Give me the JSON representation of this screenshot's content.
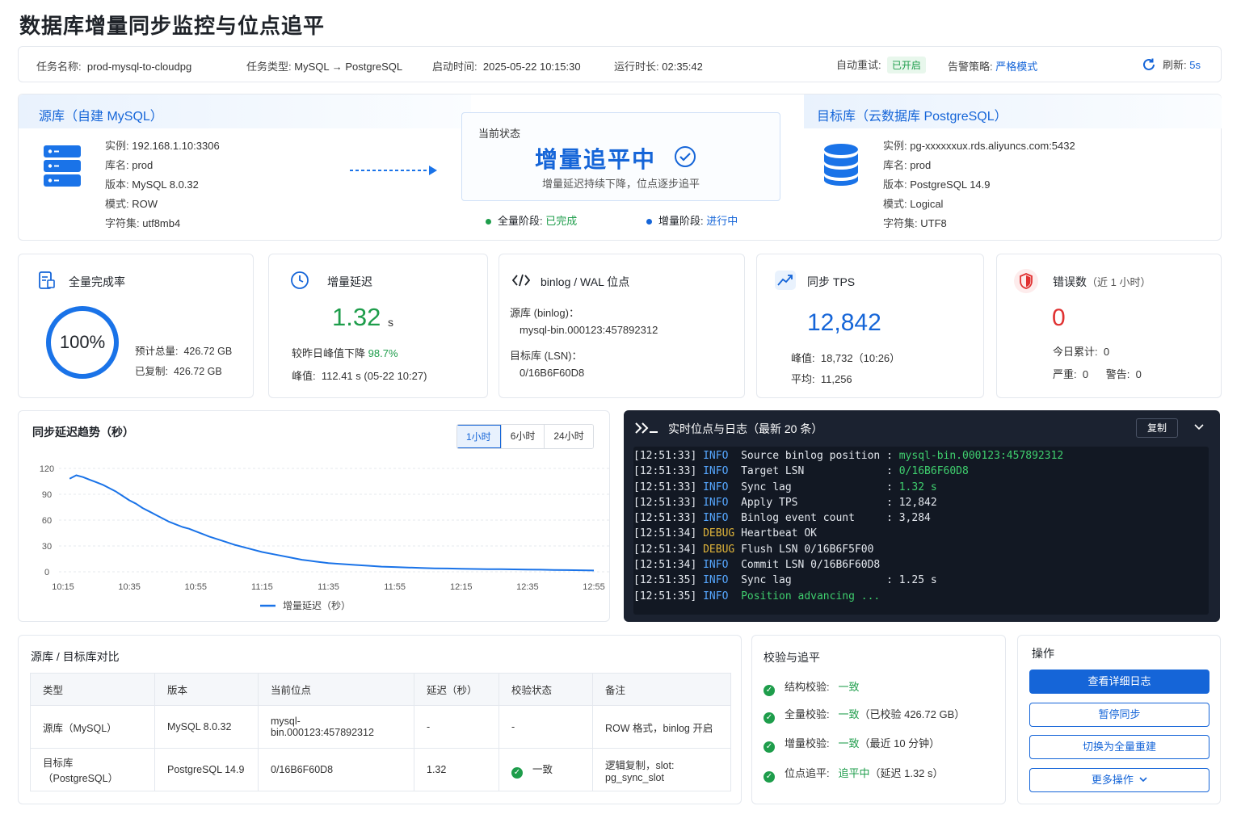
{
  "page_title": "数据库增量同步监控与位点追平",
  "infobar": {
    "task_name_label": "任务名称:",
    "task_name": "prod-mysql-to-cloudpg",
    "task_type_label": "任务类型:",
    "task_type": "MySQL → PostgreSQL",
    "start_time_label": "启动时间:",
    "start_time": "2025-05-22 10:15:30",
    "run_time_label": "运行时长:",
    "run_time": "02:35:42",
    "auto_retry_label": "自动重试:",
    "auto_retry": "已开启",
    "alert_label": "告警策略:",
    "alert": "严格模式",
    "refresh_label": "刷新:",
    "refresh": "5s"
  },
  "source": {
    "header": "源库（自建 MySQL）",
    "instance_label": "实例:",
    "instance": "192.168.1.10:3306",
    "db_label": "库名:",
    "db": "prod",
    "version_label": "版本:",
    "version": "MySQL 8.0.32",
    "mode_label": "模式:",
    "mode": "ROW",
    "charset_label": "字符集:",
    "charset": "utf8mb4"
  },
  "state": {
    "label": "当前状态",
    "value": "增量追平中",
    "sub": "增量延迟持续下降，位点逐步追平",
    "full_stage_label": "全量阶段:",
    "full_stage": "已完成",
    "incr_stage_label": "增量阶段:",
    "incr_stage": "进行中"
  },
  "target": {
    "header": "目标库（云数据库 PostgreSQL）",
    "instance_label": "实例:",
    "instance": "pg-xxxxxxux.rds.aliyuncs.com:5432",
    "db_label": "库名:",
    "db": "prod",
    "version_label": "版本:",
    "version": "PostgreSQL 14.9",
    "mode_label": "模式:",
    "mode": "Logical",
    "charset_label": "字符集:",
    "charset": "UTF8"
  },
  "metrics": {
    "full": {
      "title": "全量完成率",
      "percent": "100%",
      "percent_value": 1.0,
      "total_label": "预计总量:",
      "total": "426.72 GB",
      "copied_label": "已复制:",
      "copied": "426.72 GB"
    },
    "lag": {
      "title": "增量延迟",
      "value": "1.32",
      "unit": "s",
      "compare_label": "较昨日峰值下降",
      "compare": "98.7%",
      "peak_label": "峰值:",
      "peak": "112.41 s (05-22 10:27)"
    },
    "pos": {
      "title": "binlog / WAL 位点",
      "src_label": "源库 (binlog)：",
      "src": "mysql-bin.000123:457892312",
      "dst_label": "目标库 (LSN)：",
      "dst": "0/16B6F60D8"
    },
    "tps": {
      "title": "同步 TPS",
      "value": "12,842",
      "peak_label": "峰值:",
      "peak": "18,732（10:26）",
      "avg_label": "平均:",
      "avg": "11,256"
    },
    "err": {
      "title": "错误数",
      "title_sub": "（近 1 小时）",
      "value": "0",
      "today_label": "今日累计:",
      "today": "0",
      "severe_label": "严重:",
      "severe": "0",
      "warn_label": "警告:",
      "warn": "0"
    }
  },
  "chart": {
    "title": "同步延迟趋势（秒）",
    "ranges": [
      "1小时",
      "6小时",
      "24小时"
    ],
    "active_range": "1小时",
    "legend": "增量延迟（秒）"
  },
  "chart_data": {
    "type": "line",
    "ylim": [
      0,
      120
    ],
    "yticks": [
      "120",
      "90",
      "60",
      "30",
      "0"
    ],
    "xticks": [
      "10:15",
      "10:35",
      "10:55",
      "11:15",
      "11:35",
      "11:55",
      "12:15",
      "12:35",
      "12:55"
    ],
    "series": [
      {
        "name": "增量延迟（秒）",
        "x": [
          "10:17",
          "10:19",
          "10:21",
          "10:23",
          "10:25",
          "10:27",
          "10:29",
          "10:31",
          "10:33",
          "10:35",
          "10:37",
          "10:39",
          "10:41",
          "10:43",
          "10:45",
          "10:47",
          "10:49",
          "10:51",
          "10:53",
          "10:55",
          "10:59",
          "11:03",
          "11:07",
          "11:11",
          "11:15",
          "11:19",
          "11:23",
          "11:27",
          "11:31",
          "11:35",
          "11:39",
          "11:43",
          "11:47",
          "11:51",
          "11:55",
          "11:59",
          "12:03",
          "12:07",
          "12:11",
          "12:15",
          "12:19",
          "12:23",
          "12:27",
          "12:31",
          "12:35",
          "12:39",
          "12:43",
          "12:47",
          "12:51",
          "12:55"
        ],
        "values": [
          108,
          112,
          110,
          107,
          104,
          101,
          97,
          93,
          88,
          83,
          79,
          74,
          70,
          66,
          62,
          58,
          55,
          52,
          50,
          47,
          41,
          36,
          31,
          27,
          23,
          20,
          17,
          14,
          12,
          10,
          9,
          8,
          7,
          6,
          5.5,
          5,
          4.5,
          4,
          3.8,
          3.5,
          3.3,
          3.1,
          3.0,
          2.8,
          2.6,
          2.4,
          2.2,
          2.0,
          1.8,
          1.5
        ]
      }
    ]
  },
  "log": {
    "title": "实时位点与日志（最新 20 条）",
    "copy": "复制",
    "lines": [
      {
        "t": "[12:51:33]",
        "lvl": "INFO",
        "msg": "Source binlog position : ",
        "hl": "mysql-bin.000123:457892312"
      },
      {
        "t": "[12:51:33]",
        "lvl": "INFO",
        "msg": "Target LSN             : ",
        "hl": "0/16B6F60D8"
      },
      {
        "t": "[12:51:33]",
        "lvl": "INFO",
        "msg": "Sync lag               : ",
        "hl": "1.32 s"
      },
      {
        "t": "[12:51:33]",
        "lvl": "INFO",
        "msg": "Apply TPS              : 12,842",
        "hl": ""
      },
      {
        "t": "[12:51:33]",
        "lvl": "INFO",
        "msg": "Binlog event count     : 3,284",
        "hl": ""
      },
      {
        "t": "[12:51:34]",
        "lvl": "DEBUG",
        "msg": "Heartbeat OK",
        "hl": ""
      },
      {
        "t": "[12:51:34]",
        "lvl": "DEBUG",
        "msg": "Flush LSN 0/16B6F5F00",
        "hl": ""
      },
      {
        "t": "[12:51:34]",
        "lvl": "INFO",
        "msg": "Commit LSN 0/16B6F60D8",
        "hl": ""
      },
      {
        "t": "[12:51:35]",
        "lvl": "INFO",
        "msg": "Sync lag               : 1.25 s",
        "hl": ""
      },
      {
        "t": "[12:51:35]",
        "lvl": "INFO",
        "msg": "",
        "hl": "Position advancing ..."
      }
    ]
  },
  "compare": {
    "title": "源库 / 目标库对比",
    "headers": [
      "类型",
      "版本",
      "当前位点",
      "延迟（秒）",
      "校验状态",
      "备注"
    ],
    "rows": [
      [
        "源库（MySQL）",
        "MySQL 8.0.32",
        "mysql-bin.000123:457892312",
        "-",
        "-",
        "ROW 格式，binlog 开启"
      ],
      [
        "目标库（PostgreSQL）",
        "PostgreSQL 14.9",
        "0/16B6F60D8",
        "1.32",
        "一致",
        "逻辑复制，slot: pg_sync_slot"
      ]
    ]
  },
  "verify": {
    "title": "校验与追平",
    "items": [
      {
        "label": "结构校验:",
        "value": "一致",
        "note": ""
      },
      {
        "label": "全量校验:",
        "value": "一致",
        "note": "（已校验 426.72 GB）"
      },
      {
        "label": "增量校验:",
        "value": "一致",
        "note": "（最近 10 分钟）"
      },
      {
        "label": "位点追平:",
        "value": "追平中",
        "note": "（延迟 1.32 s）"
      }
    ]
  },
  "ops": {
    "title": "操作",
    "view_log": "查看详细日志",
    "pause": "暂停同步",
    "switch": "切换为全量重建",
    "more": "更多操作"
  },
  "colors": {
    "primary": "#1565d8",
    "success": "#1e9d4b",
    "danger": "#e03131",
    "log_bg": "#1b2230"
  }
}
